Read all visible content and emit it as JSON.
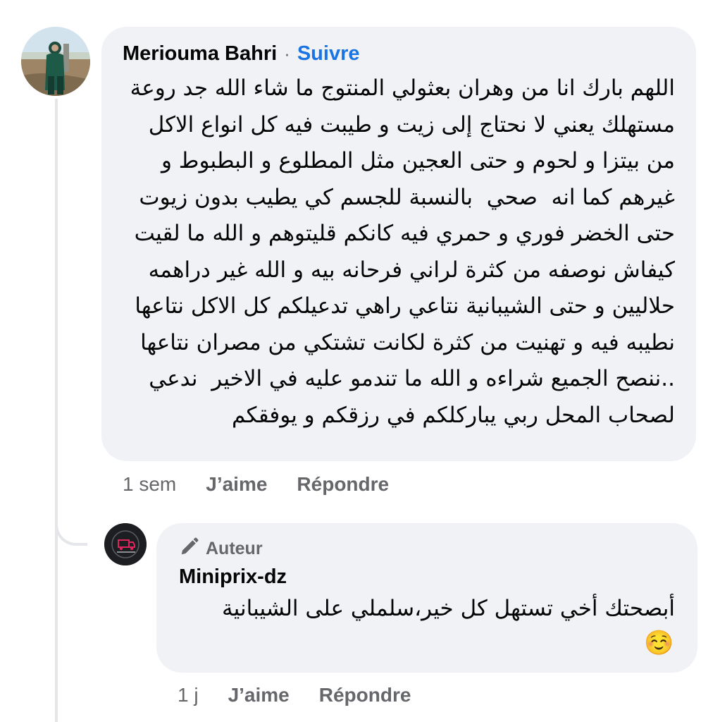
{
  "comment": {
    "author": "Meriouma Bahri",
    "separator": "·",
    "follow_label": "Suivre",
    "text": "اللهم بارك انا من وهران بعثولي المنتوج ما شاء الله جد روعة مستهلك يعني لا نحتاج إلى زيت و طيبت فيه كل انواع الاكل من بيتزا و لحوم و حتى العجين مثل المطلوع و البطبوط و غيرهم كما انه  صحي  بالنسبة للجسم كي يطيب بدون زيوت حتى الخضر فوري و حمري فيه كانكم قليتوهم و الله ما لقيت كيفاش نوصفه من كثرة لراني فرحانه بيه و الله غير دراهمه حلاليين و حتى الشيبانية نتاعي راهي تدعيلكم كل الاكل نتاعها نطيبه فيه و تهنيت من كثرة لكانت تشتكي من مصران نتاعها ..ننصح الجميع شراءه و الله ما تندمو عليه في الاخير  ندعي لصحاب المحل ربي يباركلكم في رزقكم و يوفقكم",
    "time": "1 sem",
    "like_label": "J’aime",
    "reply_label": "Répondre"
  },
  "reply": {
    "badge_label": "Auteur",
    "author": "Miniprix-dz",
    "text": "أبصحتك أخي تستهل كل خير،سلملي على الشيبانية",
    "emoji": "☺️",
    "time": "1 j",
    "like_label": "J’aime",
    "reply_label": "Répondre"
  },
  "colors": {
    "bubble": "#f0f2f5",
    "link": "#1b74e4",
    "secondary_text": "#65676b"
  },
  "icons": {
    "author_badge": "pencil-icon"
  }
}
